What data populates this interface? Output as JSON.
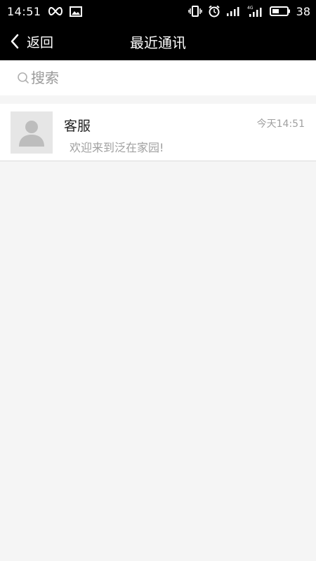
{
  "status_bar": {
    "time": "14:51",
    "battery_level": "38",
    "icons": [
      "infinity-icon",
      "image-icon",
      "vibrate-icon",
      "alarm-icon",
      "signal-icon",
      "4g-signal-icon",
      "battery-icon"
    ]
  },
  "header": {
    "back_label": "返回",
    "title": "最近通讯"
  },
  "search": {
    "placeholder": "搜索"
  },
  "conversations": [
    {
      "name": "客服",
      "time": "今天14:51",
      "preview": "欢迎来到泛在家园!"
    }
  ],
  "colors": {
    "header_bg": "#000000",
    "page_bg": "#f5f5f5",
    "secondary_text": "#a0a0a0"
  }
}
